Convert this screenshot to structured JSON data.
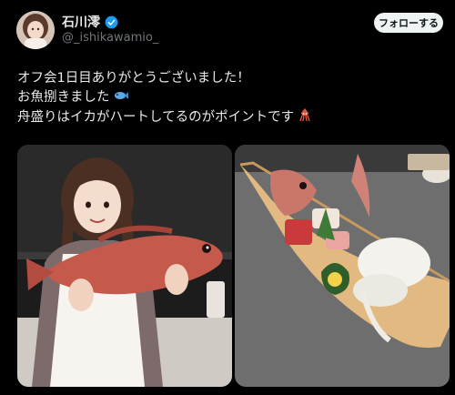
{
  "author": {
    "name": "石川澪",
    "handle": "@_ishikawamio_",
    "verified_color": "#1d9bf0",
    "avatar_icon": "profile-avatar"
  },
  "actions": {
    "follow_label": "フォローする"
  },
  "post": {
    "lines": [
      "オフ会1日目ありがとうございました！",
      "お魚捌きました",
      "舟盛りはイカがハートしてるのがポイントです"
    ],
    "emojis": [
      "fish-emoji",
      "squid-emoji"
    ]
  },
  "media": [
    {
      "name": "photo-woman-holding-sea-bream"
    },
    {
      "name": "photo-sashimi-boat-platter"
    }
  ],
  "colors": {
    "background": "#000000",
    "text": "#e7e9ea",
    "muted": "#71767b",
    "button_bg": "#eff3f4"
  }
}
